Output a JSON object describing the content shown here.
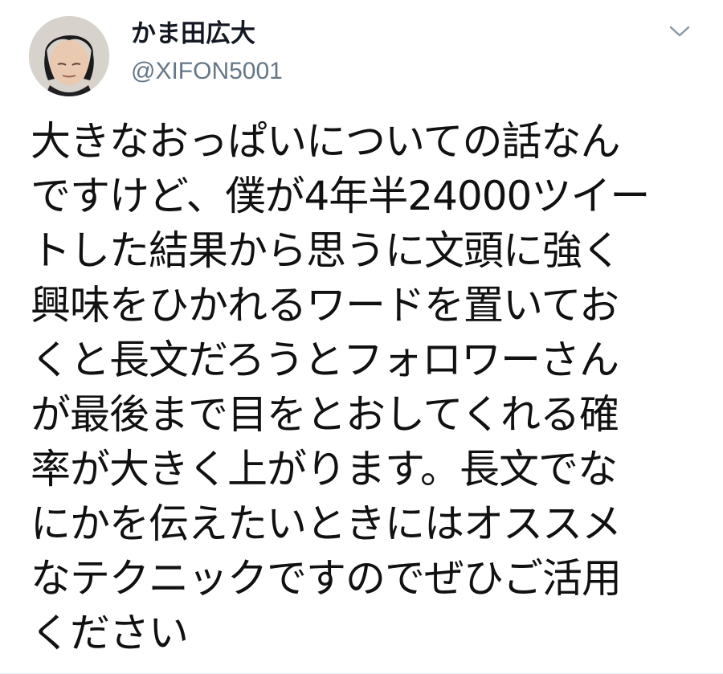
{
  "tweet": {
    "author": {
      "display_name": "かま田広大",
      "handle": "@XIFON5001",
      "avatar_icon": "user-avatar"
    },
    "menu_icon": "chevron-down-icon",
    "text_lines": [
      "大きなおっぱいについての話なん",
      "ですけど、僕が4年半24000ツイー",
      "トした結果から思うに文頭に強く",
      "興味をひかれるワードを置いてお",
      "くと長文だろうとフォロワーさん",
      "が最後まで目をとおしてくれる確",
      "率が大きく上がります。長文でな",
      "にかを伝えたいときにはオススメ",
      "なテクニックですのでぜひご活用",
      "ください"
    ]
  },
  "colors": {
    "text": "#111111",
    "name": "#141823",
    "handle": "#657786",
    "chevron": "#8899a6",
    "background": "#ffffff"
  }
}
